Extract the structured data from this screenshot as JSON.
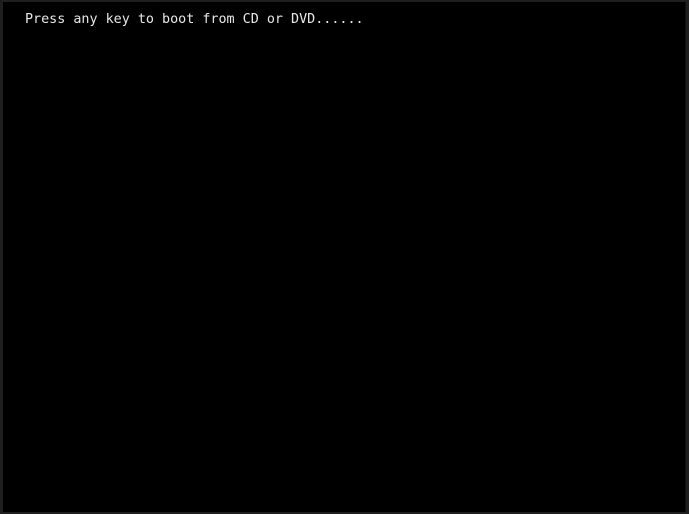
{
  "screen": {
    "type": "bios-boot-prompt",
    "background_color": "#000000",
    "text_color": "#e8e8e8",
    "message": "Press any key to boot from CD or DVD......"
  }
}
